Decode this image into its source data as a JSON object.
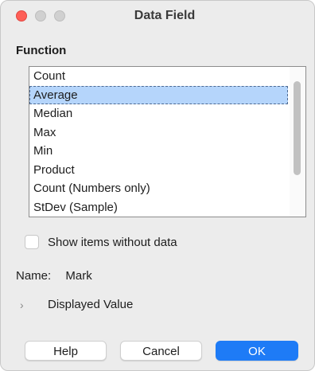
{
  "window": {
    "title": "Data Field"
  },
  "function_section": {
    "label": "Function",
    "items": [
      {
        "label": "Count"
      },
      {
        "label": "Average",
        "selected": true
      },
      {
        "label": "Median"
      },
      {
        "label": "Max"
      },
      {
        "label": "Min"
      },
      {
        "label": "Product"
      },
      {
        "label": "Count (Numbers only)"
      },
      {
        "label": "StDev (Sample)"
      }
    ]
  },
  "show_items_without_data": {
    "label": "Show items without data",
    "checked": false
  },
  "name_field": {
    "label": "Name:",
    "value": "Mark"
  },
  "displayed_value": {
    "label": "Displayed Value",
    "expanded": false
  },
  "buttons": {
    "help": "Help",
    "cancel": "Cancel",
    "ok": "OK"
  },
  "colors": {
    "accent": "#1e7bf6",
    "selection": "#b5d5fb",
    "close": "#fe5f57"
  }
}
